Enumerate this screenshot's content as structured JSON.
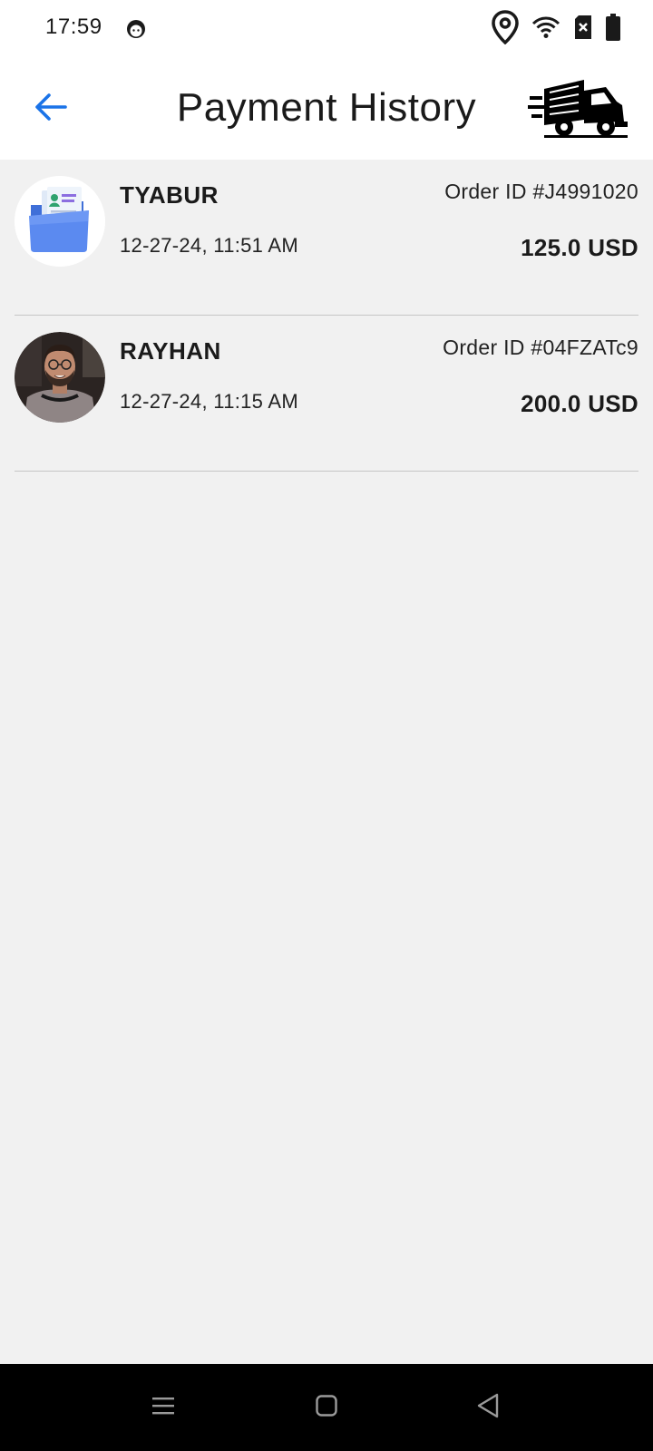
{
  "status_bar": {
    "time": "17:59",
    "icons": [
      "app-notification-icon",
      "location-icon",
      "wifi-icon",
      "sim-no-signal-icon",
      "battery-icon"
    ]
  },
  "app_bar": {
    "title": "Payment History",
    "back_icon": "arrow-left-icon",
    "logo_icon": "delivery-truck-icon",
    "accent_color": "#1a73e8"
  },
  "payments": [
    {
      "name": "TYABUR",
      "date": "12-27-24, 11:51 AM",
      "order_id": "Order ID #J4991020",
      "amount": "125.0 USD",
      "avatar": "document-folder-avatar"
    },
    {
      "name": "RAYHAN",
      "date": "12-27-24, 11:15 AM",
      "order_id": "Order ID #04FZATc9",
      "amount": "200.0 USD",
      "avatar": "user-photo-avatar"
    }
  ],
  "nav_bar": {
    "buttons": [
      "menu-icon",
      "home-icon",
      "back-triangle-icon"
    ]
  }
}
